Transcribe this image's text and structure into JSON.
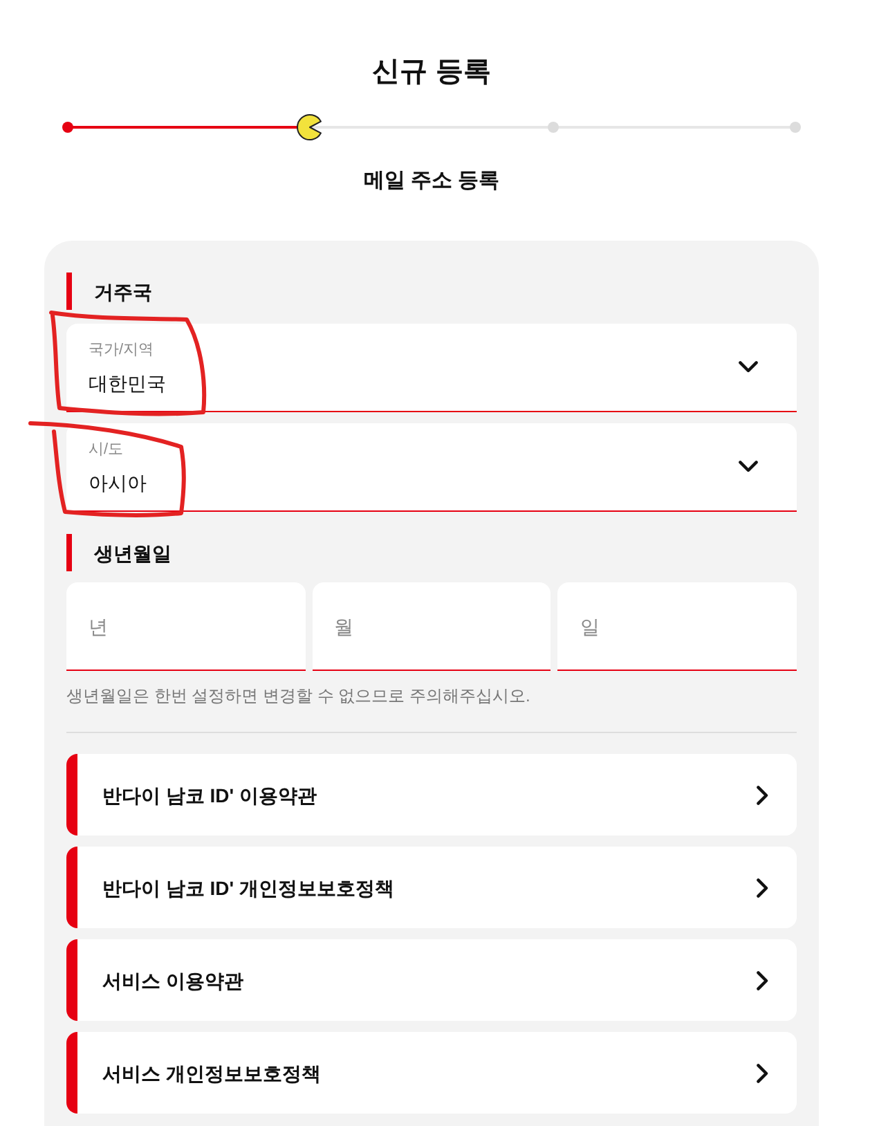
{
  "page_title": "신규 등록",
  "stepper": {
    "steps": [
      {
        "selected": false
      },
      {
        "selected": true
      },
      {
        "selected": false
      },
      {
        "selected": false
      }
    ],
    "current_label": "메일 주소 등록"
  },
  "residence": {
    "heading": "거주국",
    "selects": [
      {
        "label": "국가/지역",
        "value": "대한민국"
      },
      {
        "label": "시/도",
        "value": "아시아"
      }
    ]
  },
  "birth_date": {
    "heading": "생년월일",
    "fields": [
      {
        "placeholder": "년"
      },
      {
        "placeholder": "월"
      },
      {
        "placeholder": "일"
      }
    ],
    "note": "생년월일은 한번 설정하면 변경할 수 없으므로 주의해주십시오."
  },
  "agreements": [
    {
      "label": "반다이 남코 ID' 이용약관"
    },
    {
      "label": "반다이 남코 ID' 개인정보보호정책"
    },
    {
      "label": "서비스 이용약관"
    },
    {
      "label": "서비스 개인정보보호정책"
    }
  ]
}
